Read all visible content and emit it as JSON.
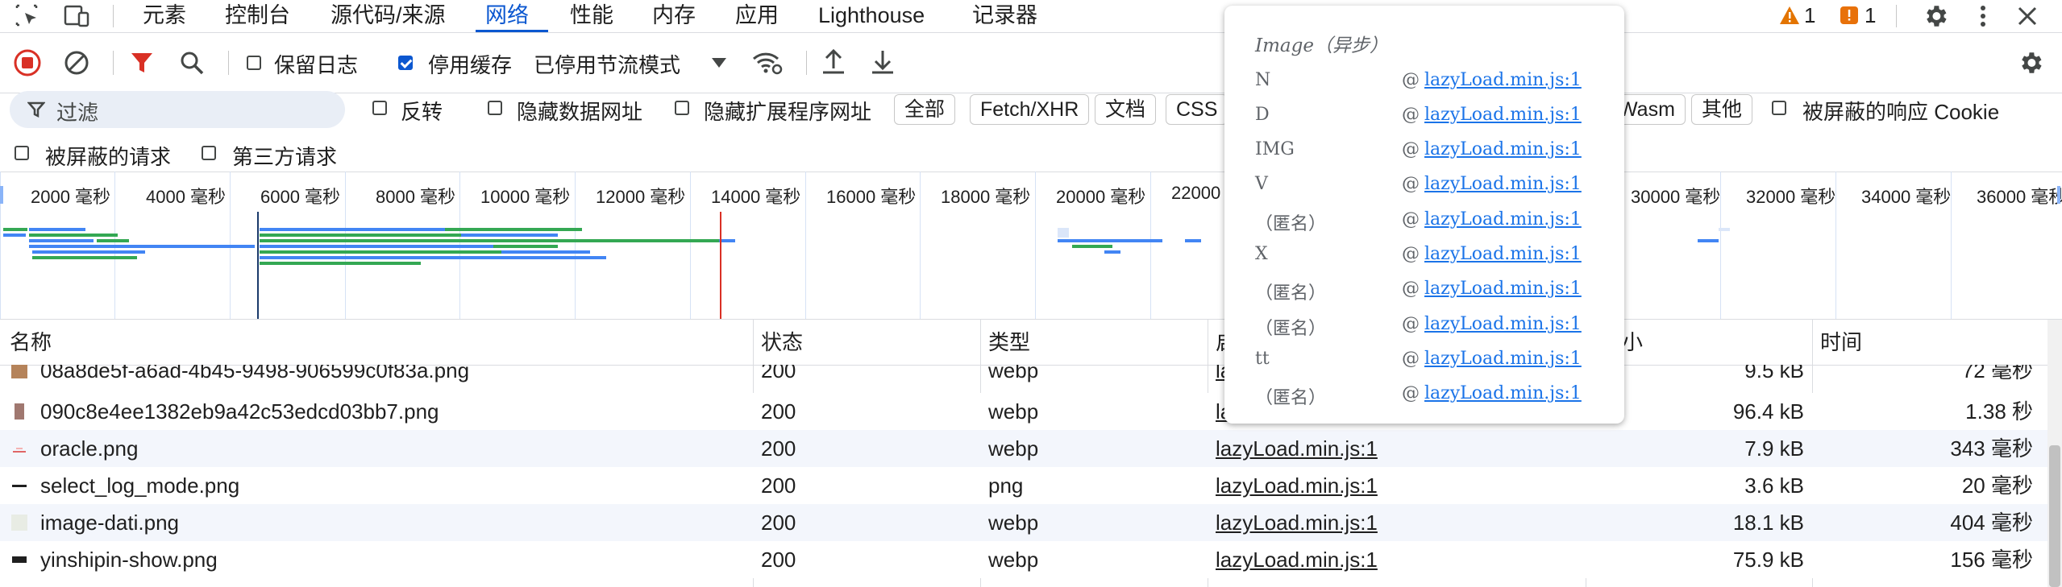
{
  "tabs": {
    "items": [
      "元素",
      "控制台",
      "源代码/来源",
      "网络",
      "性能",
      "内存",
      "应用",
      "Lighthouse",
      "记录器"
    ],
    "active": "网络"
  },
  "status": {
    "warnings": "1",
    "errors": "1"
  },
  "toolbar": {
    "preserve_log": "保留日志",
    "disable_cache": "停用缓存",
    "throttle": "已停用节流模式"
  },
  "filter": {
    "placeholder": "过滤",
    "invert": "反转",
    "hide_data_urls": "隐藏数据网址",
    "hide_extension_urls": "隐藏扩展程序网址",
    "types": [
      "全部",
      "Fetch/XHR",
      "文档",
      "CSS",
      "Wasm",
      "其他"
    ],
    "blocked_cookies": "被屏蔽的响应 Cookie",
    "blocked_requests": "被屏蔽的请求",
    "third_party": "第三方请求"
  },
  "overview": {
    "ticks": [
      "2000 毫秒",
      "4000 毫秒",
      "6000 毫秒",
      "8000 毫秒",
      "10000 毫秒",
      "12000 毫秒",
      "14000 毫秒",
      "16000 毫秒",
      "18000 毫秒",
      "20000 毫秒",
      "22000",
      "30000 毫秒",
      "32000 毫秒",
      "34000 毫秒",
      "36000 毫秒"
    ],
    "colors": {
      "waiting": "#34a853",
      "download": "#4285f4",
      "load_line": "#d93025",
      "dcl_line": "#1a3a6b"
    }
  },
  "table": {
    "headers": {
      "name": "名称",
      "status": "状态",
      "type": "类型",
      "initiator": "启",
      "size": "小",
      "time": "时间"
    },
    "rows": [
      {
        "name": "08a8de5f-a6ad-4b45-9498-906599c0f83a.png",
        "status": "200",
        "type": "webp",
        "initiator": "la",
        "size": "9.5 kB",
        "time": "72 毫秒"
      },
      {
        "name": "090c8e4ee1382eb9a42c53edcd03bb7.png",
        "status": "200",
        "type": "webp",
        "initiator": "la",
        "size": "96.4 kB",
        "time": "1.38 秒"
      },
      {
        "name": "oracle.png",
        "status": "200",
        "type": "webp",
        "initiator": "lazyLoad.min.js:1",
        "size": "7.9 kB",
        "time": "343 毫秒"
      },
      {
        "name": "select_log_mode.png",
        "status": "200",
        "type": "png",
        "initiator": "lazyLoad.min.js:1",
        "size": "3.6 kB",
        "time": "20 毫秒"
      },
      {
        "name": "image-dati.png",
        "status": "200",
        "type": "webp",
        "initiator": "lazyLoad.min.js:1",
        "size": "18.1 kB",
        "time": "404 毫秒"
      },
      {
        "name": "yinshipin-show.png",
        "status": "200",
        "type": "webp",
        "initiator": "lazyLoad.min.js:1",
        "size": "75.9 kB",
        "time": "156 毫秒"
      }
    ]
  },
  "popup": {
    "title": "Image（异步）",
    "at": "@",
    "frames": [
      {
        "fn": "N",
        "link": "lazyLoad.min.js:1"
      },
      {
        "fn": "D",
        "link": "lazyLoad.min.js:1"
      },
      {
        "fn": "IMG",
        "link": "lazyLoad.min.js:1"
      },
      {
        "fn": "V",
        "link": "lazyLoad.min.js:1"
      },
      {
        "fn": "（匿名）",
        "link": "lazyLoad.min.js:1"
      },
      {
        "fn": "X",
        "link": "lazyLoad.min.js:1"
      },
      {
        "fn": "（匿名）",
        "link": "lazyLoad.min.js:1"
      },
      {
        "fn": "（匿名）",
        "link": "lazyLoad.min.js:1"
      },
      {
        "fn": "tt",
        "link": "lazyLoad.min.js:1"
      },
      {
        "fn": "（匿名）",
        "link": "lazyLoad.min.js:1"
      }
    ]
  },
  "icons": [
    "inspect-icon",
    "device-toolbar-icon",
    "warning-icon",
    "error-icon",
    "settings-icon",
    "more-icon",
    "close-icon",
    "record-stop-icon",
    "clear-icon",
    "filter-icon",
    "search-icon",
    "dropdown-icon",
    "network-conditions-icon",
    "import-icon",
    "export-icon"
  ]
}
